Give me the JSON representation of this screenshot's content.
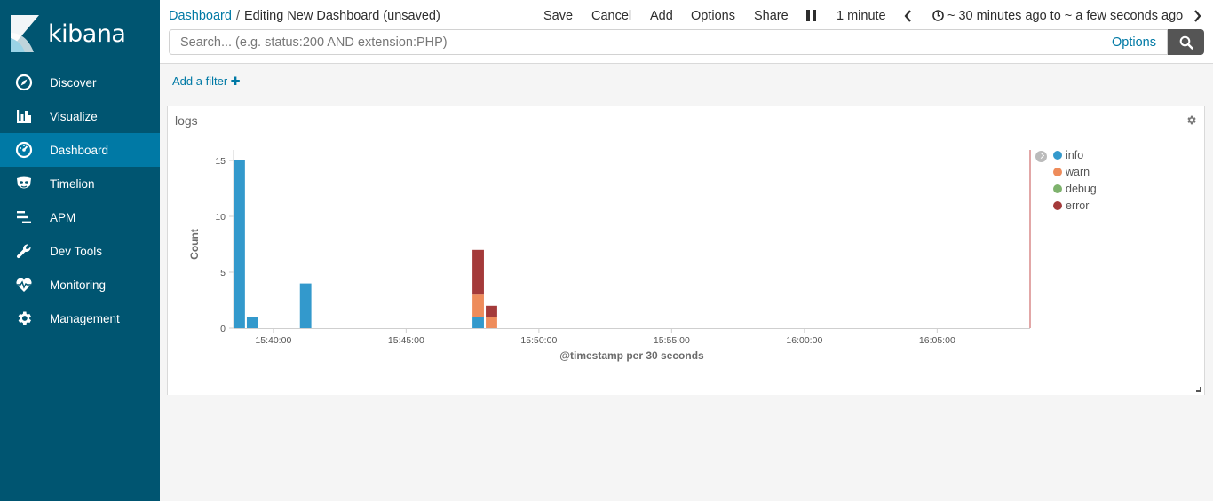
{
  "app": {
    "name": "kibana"
  },
  "sidebar": {
    "items": [
      {
        "label": "Discover",
        "icon": "compass-icon"
      },
      {
        "label": "Visualize",
        "icon": "bar-chart-icon"
      },
      {
        "label": "Dashboard",
        "icon": "dashboard-gauge-icon",
        "active": true
      },
      {
        "label": "Timelion",
        "icon": "timelion-mask-icon"
      },
      {
        "label": "APM",
        "icon": "apm-bars-icon"
      },
      {
        "label": "Dev Tools",
        "icon": "wrench-icon"
      },
      {
        "label": "Monitoring",
        "icon": "heartbeat-icon"
      },
      {
        "label": "Management",
        "icon": "gear-icon"
      }
    ]
  },
  "topbar": {
    "breadcrumb_link": "Dashboard",
    "breadcrumb_separator": "/",
    "breadcrumb_current": "Editing New Dashboard (unsaved)",
    "save_label": "Save",
    "cancel_label": "Cancel",
    "add_label": "Add",
    "options_label": "Options",
    "share_label": "Share",
    "refresh_interval": "1 minute",
    "time_range": "~ 30 minutes ago to ~ a few seconds ago"
  },
  "search": {
    "placeholder": "Search... (e.g. status:200 AND extension:PHP)",
    "value": "",
    "options_label": "Options"
  },
  "filterbar": {
    "add_filter_label": "Add a filter"
  },
  "panel": {
    "title": "logs"
  },
  "colors": {
    "sidebar_bg": "#005571",
    "sidebar_active": "#0079a5",
    "link": "#0079a5",
    "info": "#3399cc",
    "warn": "#ee8c5b",
    "debug": "#7eb26d",
    "error": "#a43a3a"
  },
  "chart_data": {
    "type": "bar",
    "stacked": true,
    "xlabel": "@timestamp per 30 seconds",
    "ylabel": "Count",
    "ylim": [
      0,
      15
    ],
    "yticks": [
      0,
      5,
      10,
      15
    ],
    "x_range": [
      "15:38:30",
      "16:08:30"
    ],
    "x_tick_labels": [
      "15:40:00",
      "15:45:00",
      "15:50:00",
      "15:55:00",
      "16:00:00",
      "16:05:00"
    ],
    "grid": false,
    "legend_position": "right",
    "series": [
      {
        "name": "info",
        "color": "#3399cc"
      },
      {
        "name": "warn",
        "color": "#ee8c5b"
      },
      {
        "name": "debug",
        "color": "#7eb26d"
      },
      {
        "name": "error",
        "color": "#a43a3a"
      }
    ],
    "bars": [
      {
        "x": "15:38:30",
        "info": 15,
        "warn": 0,
        "debug": 0,
        "error": 0
      },
      {
        "x": "15:39:00",
        "info": 1,
        "warn": 0,
        "debug": 0,
        "error": 0
      },
      {
        "x": "15:41:00",
        "info": 4,
        "warn": 0,
        "debug": 0,
        "error": 0
      },
      {
        "x": "15:47:30",
        "info": 1,
        "warn": 2,
        "debug": 0,
        "error": 4
      },
      {
        "x": "15:48:00",
        "info": 0,
        "warn": 1,
        "debug": 0,
        "error": 1
      }
    ]
  }
}
